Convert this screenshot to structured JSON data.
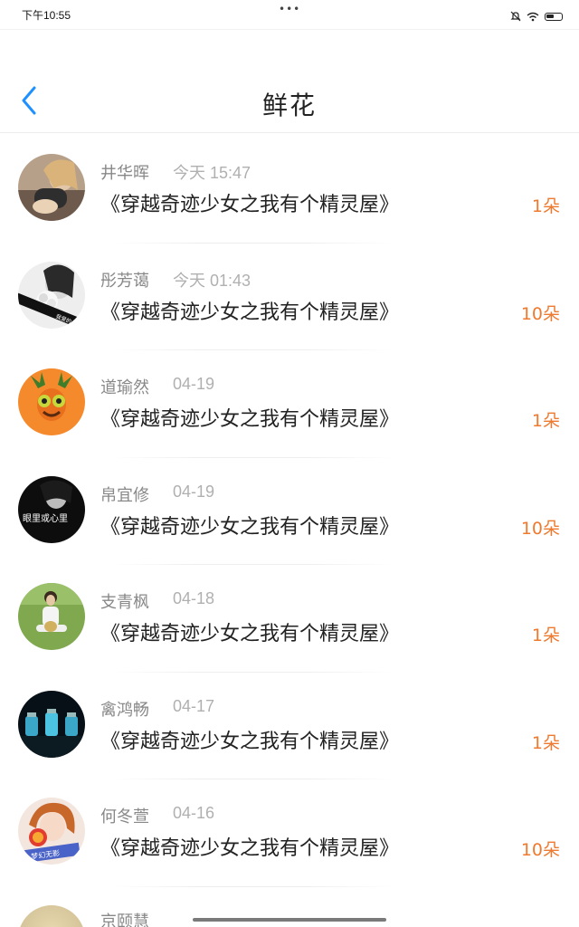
{
  "status_bar": {
    "time": "下午10:55",
    "dots": "•••"
  },
  "header": {
    "title": "鲜花"
  },
  "colors": {
    "accent_blue": "#1e90ff",
    "flower_orange": "#ee7a2f"
  },
  "items": [
    {
      "name": "井华晖",
      "date": "今天 15:47",
      "book": "《穿越奇迹少女之我有个精灵屋》",
      "count": "1朵"
    },
    {
      "name": "彤芳蔼",
      "date": "今天 01:43",
      "book": "《穿越奇迹少女之我有个精灵屋》",
      "count": "10朵"
    },
    {
      "name": "道瑜然",
      "date": "04-19",
      "book": "《穿越奇迹少女之我有个精灵屋》",
      "count": "1朵"
    },
    {
      "name": "帛宜修",
      "date": "04-19",
      "book": "《穿越奇迹少女之我有个精灵屋》",
      "count": "10朵"
    },
    {
      "name": "支青枫",
      "date": "04-18",
      "book": "《穿越奇迹少女之我有个精灵屋》",
      "count": "1朵"
    },
    {
      "name": "禽鸿畅",
      "date": "04-17",
      "book": "《穿越奇迹少女之我有个精灵屋》",
      "count": "1朵"
    },
    {
      "name": "何冬萱",
      "date": "04-16",
      "book": "《穿越奇迹少女之我有个精灵屋》",
      "count": "10朵"
    }
  ],
  "avatar_texts": {
    "item2": "我爱的 海鸥",
    "item4": "眼里或心里",
    "item7": "梦幻无影"
  },
  "partial_item": {
    "name": "京颐慧"
  }
}
